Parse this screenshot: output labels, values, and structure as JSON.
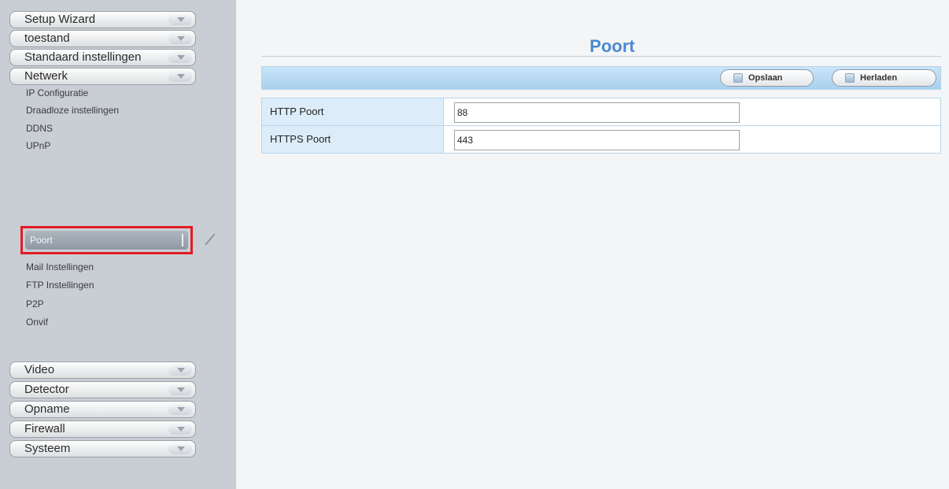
{
  "sidebar": {
    "menu_top": [
      {
        "label": "Setup Wizard"
      },
      {
        "label": "toestand"
      },
      {
        "label": "Standaard instellingen"
      },
      {
        "label": "Netwerk"
      }
    ],
    "sub_items": [
      {
        "label": "IP Configuratie"
      },
      {
        "label": "Draadloze instellingen"
      },
      {
        "label": "DDNS"
      },
      {
        "label": "UPnP"
      },
      {
        "label": "Poort"
      },
      {
        "label": "Mail Instellingen"
      },
      {
        "label": "FTP Instellingen"
      },
      {
        "label": "P2P"
      },
      {
        "label": "Onvif"
      }
    ],
    "menu_bottom": [
      {
        "label": "Video"
      },
      {
        "label": "Detector"
      },
      {
        "label": "Opname"
      },
      {
        "label": "Firewall"
      },
      {
        "label": "Systeem"
      }
    ]
  },
  "main": {
    "title": "Poort",
    "toolbar": {
      "save_label": "Opslaan",
      "reload_label": "Herladen"
    },
    "fields": [
      {
        "label": "HTTP Poort",
        "value": "88"
      },
      {
        "label": "HTTPS Poort",
        "value": "443"
      }
    ]
  }
}
